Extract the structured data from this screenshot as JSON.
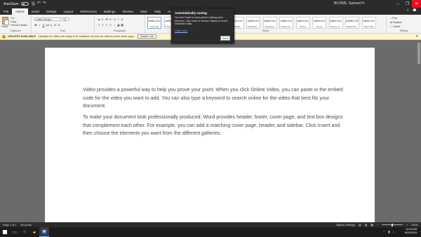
{
  "titlebar": {
    "autosave_label": "AutoSave",
    "autosave_state": "Off",
    "user": "BLOWE, Samuel H.",
    "minimize": "–",
    "restore": "❐",
    "close": "✕"
  },
  "tabs": {
    "items": [
      "File",
      "Home",
      "Insert",
      "Design",
      "Layout",
      "References",
      "Mailings",
      "Review",
      "View",
      "Help",
      "ACROBAT"
    ],
    "active": "Home",
    "tell_me": "Tell me"
  },
  "ribbon": {
    "clipboard": {
      "label": "Clipboard",
      "paste": "Paste",
      "cut": "Cut",
      "copy": "Copy",
      "format_painter": "Format Painter"
    },
    "font": {
      "label": "Font",
      "font_name": "Calibri (Body)",
      "font_size": "11"
    },
    "paragraph": {
      "label": "Paragraph"
    },
    "styles": {
      "label": "Styles",
      "tiles": [
        {
          "sample": "AaBbCcDc",
          "name": "¶ Normal"
        },
        {
          "sample": "AaBbCcDc",
          "name": "¶ No Spac..."
        },
        {
          "sample": "AaBbCc",
          "name": "Heading 1"
        },
        {
          "sample": "AaBbCcE",
          "name": "Heading 2"
        },
        {
          "sample": "AaB",
          "name": "Title"
        },
        {
          "sample": "AaBbCcDc",
          "name": "Subtitle"
        },
        {
          "sample": "AaBbCcDc",
          "name": "Subtle Em..."
        },
        {
          "sample": "AaBbCcDc",
          "name": "Emphasis"
        },
        {
          "sample": "AaBbCcDc",
          "name": "Intense E..."
        },
        {
          "sample": "AaBbCcDc",
          "name": "Strong"
        },
        {
          "sample": "AaBbCcDc",
          "name": "Quote"
        },
        {
          "sample": "AaBbCcDc",
          "name": "Intense Q..."
        },
        {
          "sample": "AABBCCDC",
          "name": "Subtle Ref..."
        },
        {
          "sample": "AaBbCcDc",
          "name": "Book Title"
        }
      ]
    },
    "editing": {
      "label": "Editing",
      "find": "Find",
      "replace": "Replace",
      "select": "Select"
    }
  },
  "update_bar": {
    "title": "UPDATES AVAILABLE",
    "message": "Updates for Office are ready to be installed, but first we need to close some apps.",
    "button": "Update now"
  },
  "popup": {
    "title": "Automatically saving",
    "body": "You don't have to worry about clicking save anymore. Use Undo or Version History to revert unwanted edits.",
    "link": "Learn more",
    "button": "Got it"
  },
  "document": {
    "paragraphs": [
      "Video provides a powerful way to help you prove your point. When you click Online Video, you can paste in the embed code for the video you want to add. You can also type a keyword to search online for the video that best fits your document.",
      "To make your document look professionally produced, Word provides header, footer, cover page, and text box designs that complement each other. For example, you can add a matching cover page, header, and sidebar. Click Insert and then choose the elements you want from the different galleries."
    ]
  },
  "statusbar": {
    "page": "Page 1 of 1",
    "words": "96 words",
    "display_settings": "Display Settings",
    "zoom": "100%"
  },
  "taskbar": {
    "time": "12:03 AM",
    "date": "8/22/2019"
  },
  "colors": {
    "accent_word": "#2b579a",
    "close_red": "#e81123",
    "update_bar": "#fff4ce"
  }
}
